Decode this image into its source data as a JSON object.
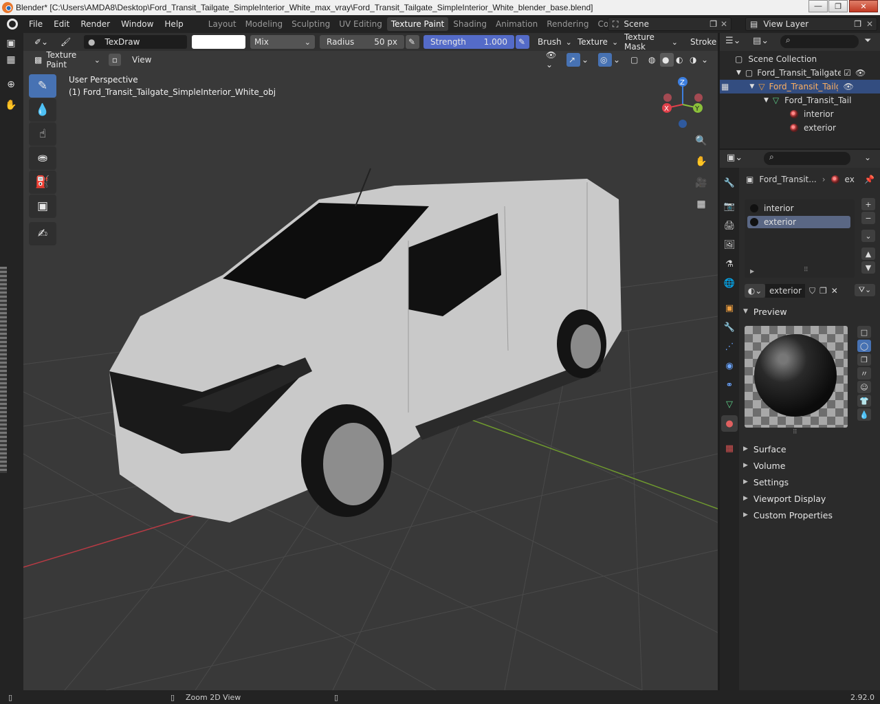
{
  "window": {
    "title": "Blender* [C:\\Users\\AMDA8\\Desktop\\Ford_Transit_Tailgate_SimpleInterior_White_max_vray\\Ford_Transit_Tailgate_SimpleInterior_White_blender_base.blend]",
    "minimize": "—",
    "restore": "❐",
    "close": "✕"
  },
  "menu": {
    "items": [
      "File",
      "Edit",
      "Render",
      "Window",
      "Help"
    ]
  },
  "workspaces": [
    "Layout",
    "Modeling",
    "Sculpting",
    "UV Editing",
    "Texture Paint",
    "Shading",
    "Animation",
    "Rendering",
    "Compositing"
  ],
  "active_workspace": "Texture Paint",
  "scene": {
    "label": "Scene"
  },
  "view_layer": {
    "label": "View Layer"
  },
  "toolheader": {
    "brush_name": "TexDraw",
    "blend_mode": "Mix",
    "radius_label": "Radius",
    "radius_value": "50 px",
    "strength_label": "Strength",
    "strength_value": "1.000",
    "brush_menu": "Brush",
    "texture_menu": "Texture",
    "texture_mask_menu": "Texture Mask",
    "stroke_menu": "Stroke"
  },
  "header2": {
    "mode": "Texture Paint",
    "view_menu": "View"
  },
  "viewport": {
    "perspective": "User Perspective",
    "object_info": "(1) Ford_Transit_Tailgate_SimpleInterior_White_obj",
    "gizmo": {
      "z": "Z",
      "x": "X",
      "y": "Y"
    },
    "colors": {
      "x_axis": "#e0404a",
      "y_axis": "#8bc03a",
      "z_axis": "#3d7fe0",
      "background": "#393939"
    }
  },
  "outliner": {
    "root": "Scene Collection",
    "collection": "Ford_Transit_Tailgate_Sir",
    "object": "Ford_Transit_Tailgate",
    "mesh": "Ford_Transit_Tail",
    "materials": [
      "interior",
      "exterior"
    ]
  },
  "properties": {
    "object_name": "Ford_Transit...",
    "material_short": "ex",
    "slots": [
      "interior",
      "exterior"
    ],
    "selected_slot": "exterior",
    "material_field": "exterior",
    "preview_label": "Preview",
    "panels": [
      "Surface",
      "Volume",
      "Settings",
      "Viewport Display",
      "Custom Properties"
    ]
  },
  "statusbar": {
    "hint": "Zoom 2D View",
    "version": "2.92.0"
  }
}
